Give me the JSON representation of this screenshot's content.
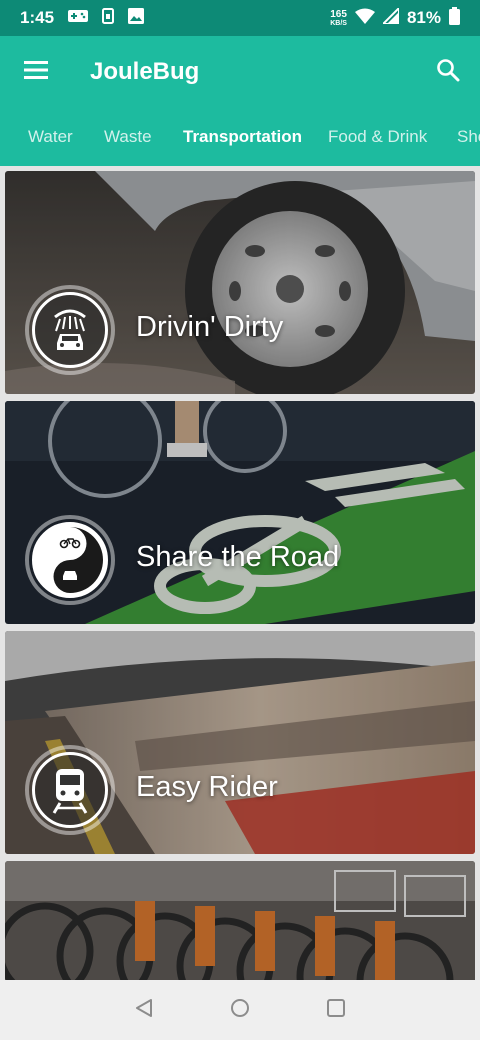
{
  "status_bar": {
    "time": "1:45",
    "speed_value": "165",
    "speed_unit": "KB/S",
    "battery": "81%",
    "icons": [
      "gamepad-icon",
      "sim-icon",
      "image-icon",
      "wifi-icon",
      "signal-icon",
      "battery-icon"
    ]
  },
  "app_bar": {
    "title": "JouleBug",
    "menu_icon": "hamburger-menu-icon",
    "search_icon": "search-icon"
  },
  "tabs": [
    {
      "label": "Water",
      "active": false
    },
    {
      "label": "Waste",
      "active": false
    },
    {
      "label": "Transportation",
      "active": true
    },
    {
      "label": "Food & Drink",
      "active": false
    },
    {
      "label": "Sho",
      "active": false
    }
  ],
  "cards": [
    {
      "title": "Drivin' Dirty",
      "icon": "car-wash-icon"
    },
    {
      "title": "Share the Road",
      "icon": "bike-car-yin-yang-icon"
    },
    {
      "title": "Easy Rider",
      "icon": "train-icon"
    },
    {
      "title": "",
      "icon": ""
    }
  ],
  "nav_bar": {
    "icons": [
      "back-icon",
      "home-icon",
      "recents-icon"
    ]
  },
  "colors": {
    "status_bar": "#0d8a76",
    "app_bar": "#1dbb9f",
    "nav_bar": "#efefef"
  }
}
